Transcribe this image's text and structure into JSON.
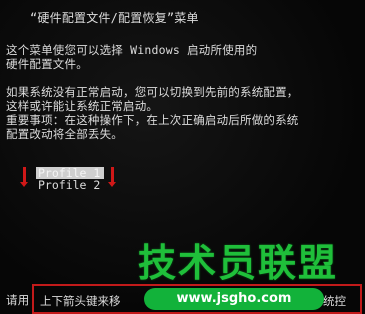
{
  "screen": {
    "menu_title": "“硬件配置文件/配置恢复”菜单",
    "description": [
      "这个菜单使您可以选择 Windows 启动所使用的",
      "硬件配置文件。"
    ],
    "warning": [
      "如果系统没有正常启动，您可以切换到先前的系统配置，",
      "这样或许能让系统正常启动。",
      "重要事项：在这种操作下，在上次正确启动后所做的系统",
      "配置改动将全部丢失。"
    ],
    "profiles": [
      {
        "label": "Profile 1",
        "selected": true
      },
      {
        "label": "Profile 2",
        "selected": false
      }
    ],
    "hint_prefix": "请用",
    "hint_text": "上下箭头键来移",
    "hint_suffix": "的系统控"
  },
  "annotation": {
    "color": "#d01818"
  },
  "watermark": {
    "brand": "技术员联盟",
    "url": "www.jsgho.com",
    "color": "#1fbf3a"
  }
}
